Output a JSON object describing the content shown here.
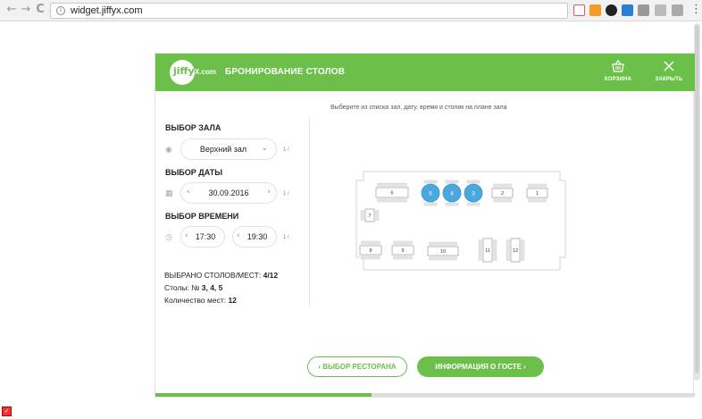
{
  "browser": {
    "url": "widget.jiffyx.com",
    "back": "←",
    "forward": "→",
    "reload": "C",
    "menu": "⋮"
  },
  "header": {
    "logo_text": "jiffy",
    "logo_suffix": "X.com",
    "title": "БРОНИРОВАНИЕ СТОЛОВ",
    "cart_label": "КОРЗИНА",
    "close_label": "ЗАКРЫТЬ",
    "accent": "#6cc04a"
  },
  "hint": "Выберите из списка зал, дату, время и столик на плане зала",
  "hall": {
    "title": "ВЫБОР ЗАЛА",
    "selected": "Верхний зал",
    "counter": "1 /"
  },
  "date": {
    "title": "ВЫБОР ДАТЫ",
    "selected": "30.09.2016",
    "counter": "1 /"
  },
  "time": {
    "title": "ВЫБОР ВРЕМЕНИ",
    "from": "17:30",
    "to": "19:30",
    "counter": "1 /"
  },
  "summary": {
    "line1_label": "ВЫБРАНО СТОЛОВ/МЕСТ: ",
    "line1_value": "4/12",
    "line2_label": "Столы: № ",
    "line2_value": "3, 4, 5",
    "line3_label": "Количество мест: ",
    "line3_value": "12"
  },
  "plan": {
    "tables": [
      {
        "id": "6",
        "selected": false
      },
      {
        "id": "5",
        "selected": true
      },
      {
        "id": "4",
        "selected": true
      },
      {
        "id": "3",
        "selected": true
      },
      {
        "id": "2",
        "selected": false
      },
      {
        "id": "1",
        "selected": false
      },
      {
        "id": "7",
        "selected": false
      },
      {
        "id": "8",
        "selected": false
      },
      {
        "id": "9",
        "selected": false
      },
      {
        "id": "10",
        "selected": false
      },
      {
        "id": "11",
        "selected": false
      },
      {
        "id": "12",
        "selected": false
      }
    ],
    "selected_color": "#4aa8de"
  },
  "buttons": {
    "back_label": "‹  ВЫБОР РЕСТОРАНА",
    "next_label": "ИНФОРМАЦИЯ О ГОСТЕ  ›"
  },
  "progress": 0.4
}
